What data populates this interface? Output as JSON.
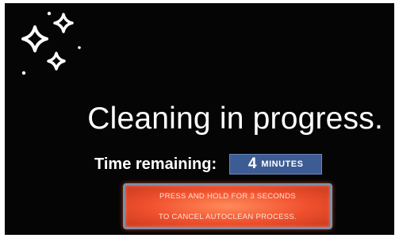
{
  "screen": {
    "background": "#050505",
    "decoration": "sparkles-icon"
  },
  "status": {
    "title": "Cleaning in progress."
  },
  "timer": {
    "label": "Time remaining:",
    "value": "4",
    "unit": "MINUTES"
  },
  "cancel_button": {
    "line1": "PRESS AND HOLD FOR 3 SECONDS",
    "line2": "TO CANCEL AUTOCLEAN PROCESS.",
    "color": "#f0502e"
  }
}
